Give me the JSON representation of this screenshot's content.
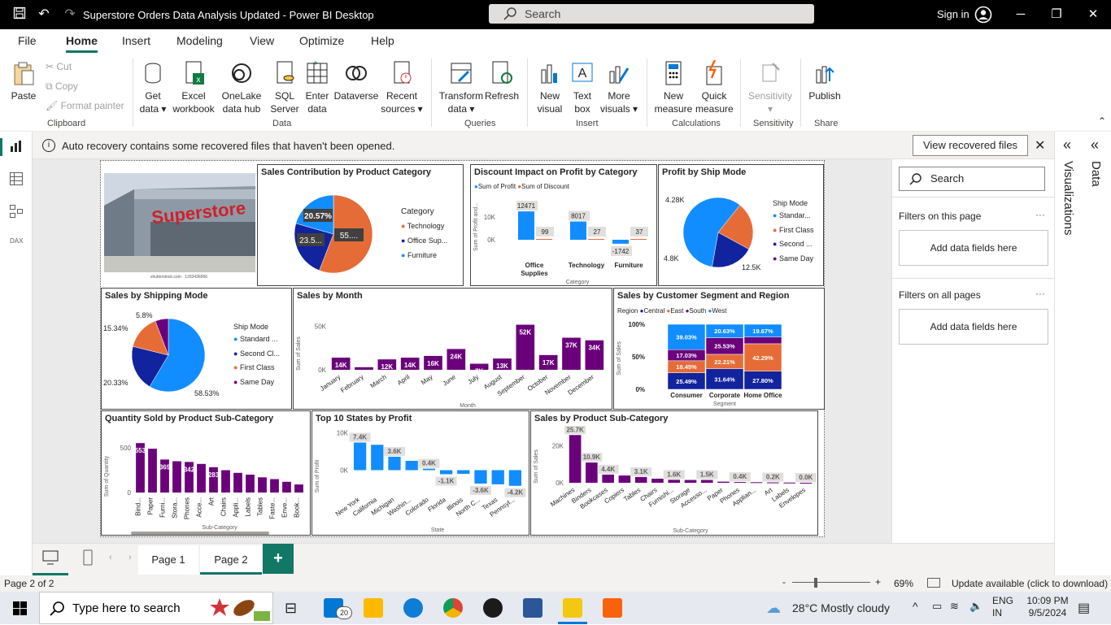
{
  "window": {
    "title": "Superstore Orders Data Analysis Updated - Power BI Desktop",
    "search_placeholder": "Search",
    "sign_in": "Sign in"
  },
  "menu": {
    "items": [
      "File",
      "Home",
      "Insert",
      "Modeling",
      "View",
      "Optimize",
      "Help"
    ],
    "active": "Home"
  },
  "ribbon": {
    "clipboard": {
      "paste": "Paste",
      "cut": "Cut",
      "copy": "Copy",
      "format_painter": "Format painter",
      "group": "Clipboard"
    },
    "data": {
      "get_data": "Get data",
      "excel": "Excel workbook",
      "onelake": "OneLake data hub",
      "sql": "SQL Server",
      "enter": "Enter data",
      "dataverse": "Dataverse",
      "recent": "Recent sources",
      "group": "Data"
    },
    "queries": {
      "transform": "Transform data",
      "refresh": "Refresh",
      "group": "Queries"
    },
    "insert": {
      "new_visual": "New visual",
      "text_box": "Text box",
      "more_visuals": "More visuals",
      "group": "Insert"
    },
    "calculations": {
      "new_measure": "New measure",
      "quick_measure": "Quick measure",
      "group": "Calculations"
    },
    "sensitivity": {
      "label": "Sensitivity",
      "group": "Sensitivity"
    },
    "share": {
      "publish": "Publish",
      "group": "Share"
    }
  },
  "infobar": {
    "message": "Auto recovery contains some recovered files that haven't been opened.",
    "button": "View recovered files"
  },
  "visuals": {
    "image_caption": "shutterstock.com · 1203436956",
    "image_sign": "Superstore",
    "sales_contribution": {
      "title": "Sales Contribution by Product Category",
      "legend_title": "Category",
      "legend": [
        "Technology",
        "Office Sup...",
        "Furniture"
      ],
      "labels": [
        "20.57%",
        "23.5...",
        "55...."
      ]
    },
    "discount_impact": {
      "title": "Discount Impact on Profit by Category",
      "legend": [
        "Sum of Profit",
        "Sum of Discount"
      ],
      "y_title": "Sum of Profit and...",
      "x_title": "Category",
      "ticks": [
        "10K",
        "0K"
      ],
      "labels": [
        "12471",
        "99",
        "8017",
        "27",
        "37",
        "-1742"
      ],
      "categories": [
        "Office Supplies",
        "Technology",
        "Furniture"
      ]
    },
    "profit_ship_mode": {
      "title": "Profit by Ship Mode",
      "legend_title": "Ship Mode",
      "legend": [
        "Standar...",
        "First Class",
        "Second ...",
        "Same Day"
      ],
      "labels": [
        "4.28K",
        "4.8K",
        "12.5K"
      ]
    },
    "sales_shipping_mode": {
      "title": "Sales by Shipping Mode",
      "legend_title": "Ship Mode",
      "legend": [
        "Standard ...",
        "Second Cl...",
        "First Class",
        "Same Day"
      ],
      "labels": [
        "5.8%",
        "15.34%",
        "20.33%",
        "58.53%"
      ]
    },
    "sales_by_month": {
      "title": "Sales by Month",
      "y_title": "Sum of Sales",
      "x_title": "Month",
      "ticks": [
        "50K",
        "0K"
      ]
    },
    "segment_region": {
      "title": "Sales by Customer Segment and Region",
      "legend_title": "Region",
      "legend": [
        "Central",
        "East",
        "South",
        "West"
      ],
      "y_title": "Sum of Sales",
      "x_title": "Segment",
      "ticks": [
        "100%",
        "50%",
        "0%"
      ]
    },
    "qty_subcategory": {
      "title": "Quantity Sold by Product Sub-Category",
      "y_title": "Sum of Quantity",
      "x_title": "Sub-Category",
      "ticks": [
        "500",
        "0"
      ],
      "labels": [
        "553",
        "369",
        "342",
        "283"
      ]
    },
    "top_states": {
      "title": "Top 10 States by Profit",
      "y_title": "Sum of Profit",
      "x_title": "State",
      "ticks": [
        "10K",
        "0K"
      ]
    },
    "sales_subcategory": {
      "title": "Sales by Product Sub-Category",
      "y_title": "Sum of Sales",
      "x_title": "Sub-Category",
      "ticks": [
        "20K",
        "0K"
      ]
    }
  },
  "filters": {
    "search": "Search",
    "this_page": "Filters on this page",
    "all_pages": "Filters on all pages",
    "add": "Add data fields here"
  },
  "side_panes": {
    "visualizations": "Visualizations",
    "data": "Data"
  },
  "pages": {
    "tabs": [
      "Page 1",
      "Page 2"
    ],
    "active": "Page 2",
    "add": "+"
  },
  "status": {
    "page": "Page 2 of 2",
    "zoom": "69%",
    "update": "Update available (click to download)"
  },
  "taskbar": {
    "search": "Type here to search",
    "weather": "28°C  Mostly cloudy",
    "lang1": "ENG",
    "lang2": "IN",
    "time": "10:09 PM",
    "date": "9/5/2024",
    "mail_badge": "20"
  },
  "chart_data": [
    {
      "type": "pie",
      "title": "Sales Contribution by Product Category",
      "categories": [
        "Technology",
        "Office Supplies",
        "Furniture"
      ],
      "values": [
        55.9,
        23.5,
        20.57
      ],
      "colors": [
        "#E66C37",
        "#12239E",
        "#118DFF"
      ]
    },
    {
      "type": "bar",
      "title": "Discount Impact on Profit by Category",
      "categories": [
        "Office Supplies",
        "Technology",
        "Furniture"
      ],
      "series": [
        {
          "name": "Sum of Profit",
          "values": [
            12471,
            8017,
            -1742
          ]
        },
        {
          "name": "Sum of Discount",
          "values": [
            99,
            27,
            37
          ]
        }
      ]
    },
    {
      "type": "pie",
      "title": "Profit by Ship Mode",
      "categories": [
        "Standard Class",
        "First Class",
        "Second Class",
        "Same Day"
      ],
      "values": [
        12500,
        4800,
        4280,
        0
      ],
      "colors": [
        "#118DFF",
        "#E66C37",
        "#12239E",
        "#6B007B"
      ]
    },
    {
      "type": "pie",
      "title": "Sales by Shipping Mode",
      "categories": [
        "Standard Class",
        "Second Class",
        "First Class",
        "Same Day"
      ],
      "values": [
        58.53,
        20.33,
        15.34,
        5.8
      ],
      "colors": [
        "#118DFF",
        "#12239E",
        "#E66C37",
        "#6B007B"
      ]
    },
    {
      "type": "bar",
      "title": "Sales by Month",
      "categories": [
        "January",
        "February",
        "March",
        "April",
        "May",
        "June",
        "July",
        "August",
        "September",
        "October",
        "November",
        "December"
      ],
      "values": [
        14000,
        3000,
        12000,
        14000,
        16000,
        24000,
        7000,
        13000,
        52000,
        17000,
        37000,
        34000
      ],
      "labels": [
        "14K",
        "3K",
        "12K",
        "14K",
        "16K",
        "24K",
        "7K",
        "13K",
        "52K",
        "17K",
        "37K",
        "34K"
      ],
      "ylim": [
        0,
        60000
      ],
      "color": "#6B007B"
    },
    {
      "type": "bar",
      "title": "Sales by Customer Segment and Region",
      "categories": [
        "Consumer",
        "Corporate",
        "Home Office"
      ],
      "series": [
        {
          "name": "Central",
          "values": [
            25.49,
            31.64,
            27.8
          ],
          "color": "#12239E"
        },
        {
          "name": "East",
          "values": [
            18.45,
            22.21,
            42.29
          ],
          "color": "#E66C37"
        },
        {
          "name": "South",
          "values": [
            17.03,
            25.53,
            10.24
          ],
          "color": "#6B007B"
        },
        {
          "name": "West",
          "values": [
            39.03,
            20.63,
            19.67
          ],
          "color": "#118DFF"
        }
      ],
      "labels": [
        [
          "25.49%",
          "18.45%",
          "17.03%",
          "39.03%"
        ],
        [
          "31.64%",
          "22.21%",
          "25.53%",
          "20.63%"
        ],
        [
          "27.80%",
          "42.29%",
          "",
          "19.67%"
        ]
      ]
    },
    {
      "type": "bar",
      "title": "Quantity Sold by Product Sub-Category",
      "categories": [
        "Bind...",
        "Paper",
        "Furni...",
        "Stora...",
        "Phones",
        "Acce...",
        "Art",
        "Chairs",
        "Appli...",
        "Labels",
        "Tables",
        "Faste...",
        "Enve...",
        "Book..."
      ],
      "values": [
        553,
        490,
        369,
        350,
        342,
        320,
        283,
        250,
        220,
        200,
        170,
        150,
        120,
        90
      ],
      "labels": [
        "553",
        "",
        "369",
        "",
        "342",
        "",
        "283",
        "",
        "",
        "",
        "",
        "",
        "",
        ""
      ],
      "ylim": [
        0,
        600
      ],
      "color": "#6B007B"
    },
    {
      "type": "bar",
      "title": "Top 10 States by Profit",
      "categories": [
        "New York",
        "California",
        "Michigan",
        "Washin...",
        "Colorado",
        "Florida",
        "Illinois",
        "North C...",
        "Texas",
        "Pennsyl..."
      ],
      "values": [
        7400,
        6800,
        3600,
        2500,
        400,
        -1100,
        -1000,
        -3600,
        -3800,
        -4200
      ],
      "labels": [
        "7.4K",
        "",
        "3.6K",
        "",
        "0.4K",
        "-1.1K",
        "",
        "-3.6K",
        "",
        "-4.2K"
      ],
      "ylim": [
        -6000,
        11000
      ],
      "color": "#118DFF"
    },
    {
      "type": "bar",
      "title": "Sales by Product Sub-Category",
      "categories": [
        "Machines",
        "Binders",
        "Bookcases",
        "Copiers",
        "Tables",
        "Chairs",
        "Furnishi...",
        "Storage",
        "Accesso...",
        "Paper",
        "Phones",
        "Applian...",
        "Art",
        "Labels",
        "Envelopes"
      ],
      "values": [
        25700,
        10900,
        4400,
        3900,
        3100,
        2200,
        1600,
        1500,
        1500,
        600,
        400,
        300,
        200,
        100,
        0
      ],
      "labels": [
        "25.7K",
        "10.9K",
        "4.4K",
        "",
        "3.1K",
        "",
        "1.6K",
        "",
        "1.5K",
        "",
        "0.4K",
        "",
        "0.2K",
        "",
        "0.0K"
      ],
      "ylim": [
        0,
        28000
      ],
      "color": "#6B007B"
    }
  ]
}
